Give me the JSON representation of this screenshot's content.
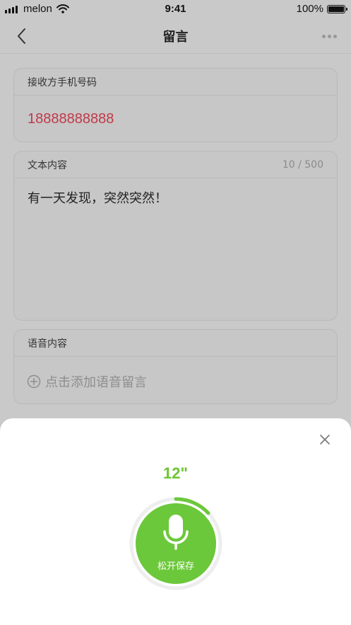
{
  "status_bar": {
    "carrier": "melon",
    "time": "9:41",
    "battery": "100%",
    "signal_icon": "signal-bars-icon",
    "wifi_icon": "wifi-icon",
    "battery_icon": "battery-icon"
  },
  "nav": {
    "title": "留言",
    "back_icon": "chevron-left-icon",
    "more_icon": "more-dots-icon"
  },
  "phone_card": {
    "label": "接收方手机号码",
    "value": "18888888888",
    "value_color": "#c0394a"
  },
  "text_card": {
    "label": "文本内容",
    "count": "10 / 500",
    "content": "有一天发现，突然突然！"
  },
  "voice_card": {
    "label": "语音内容",
    "add_label": "点击添加语音留言",
    "add_icon": "plus-circle-icon"
  },
  "record_sheet": {
    "timer": "12\"",
    "button_label": "松开保存",
    "mic_icon": "microphone-icon",
    "close_icon": "close-icon",
    "progress": 0.13,
    "accent_color": "#6cc83b"
  }
}
